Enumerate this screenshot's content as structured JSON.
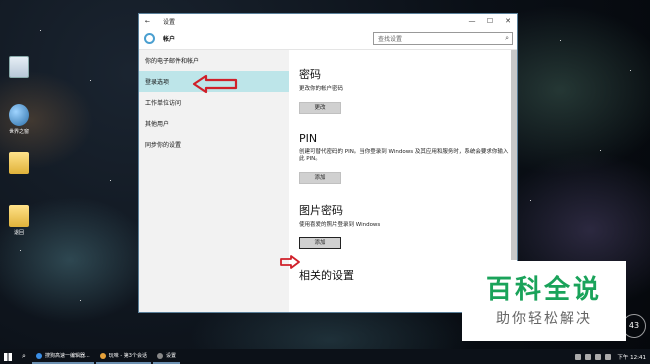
{
  "desktop": {
    "icons": [
      {
        "label": ""
      },
      {
        "label": "世界之窗"
      },
      {
        "label": ""
      },
      {
        "label": "退回"
      }
    ]
  },
  "window": {
    "title": "设置",
    "header_title": "帐户",
    "search_placeholder": "查找设置",
    "controls": {
      "minimize": "—",
      "maximize": "☐",
      "close": "✕"
    },
    "back": "←"
  },
  "sidebar": {
    "items": [
      {
        "label": "你的电子邮件和帐户"
      },
      {
        "label": "登录选项",
        "selected": true
      },
      {
        "label": "工作单位访问"
      },
      {
        "label": "其他用户"
      },
      {
        "label": "同步你的设置"
      }
    ]
  },
  "content": {
    "password": {
      "heading": "密码",
      "desc": "更改你的帐户密码",
      "button": "更改"
    },
    "pin": {
      "heading": "PIN",
      "desc": "创建可替代密码的 PIN。当你登录到 Windows 及其应用和服务时，系统会要求你输入此 PIN。",
      "button": "添加"
    },
    "picture": {
      "heading": "图片密码",
      "desc": "使用喜爱的照片登录到 Windows",
      "button": "添加"
    },
    "related": {
      "heading": "相关的设置"
    }
  },
  "watermark": {
    "big": "百科全说",
    "small": "助你轻松解决"
  },
  "clock_badge": "43",
  "taskbar": {
    "items": [
      {
        "label": "搜狗高速一编辑器..."
      },
      {
        "label": "玩味 - 第3个会话"
      },
      {
        "label": "设置"
      }
    ],
    "time": "下午 12:41"
  },
  "colors": {
    "accent": "#4a9fd0",
    "selected_bg": "#bde5e9",
    "arrow": "#d0202a",
    "watermark_green": "#1aa35a"
  }
}
